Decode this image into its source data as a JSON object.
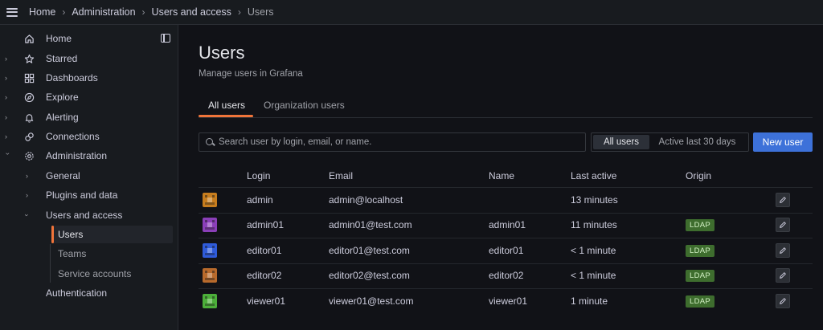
{
  "breadcrumb": [
    "Home",
    "Administration",
    "Users and access",
    "Users"
  ],
  "sidebar": {
    "items": [
      {
        "label": "Home",
        "icon": "home-icon",
        "expandable": false
      },
      {
        "label": "Starred",
        "icon": "star-icon",
        "expandable": true
      },
      {
        "label": "Dashboards",
        "icon": "dashboards-icon",
        "expandable": true
      },
      {
        "label": "Explore",
        "icon": "compass-icon",
        "expandable": true
      },
      {
        "label": "Alerting",
        "icon": "bell-icon",
        "expandable": true
      },
      {
        "label": "Connections",
        "icon": "connections-icon",
        "expandable": true
      },
      {
        "label": "Administration",
        "icon": "gear-icon",
        "expandable": true,
        "expanded": true
      }
    ],
    "admin_children": [
      "General",
      "Plugins and data",
      "Users and access",
      "Authentication"
    ],
    "users_access_children": [
      "Users",
      "Teams",
      "Service accounts"
    ],
    "active": "Users"
  },
  "page": {
    "title": "Users",
    "subtitle": "Manage users in Grafana"
  },
  "tabs": [
    {
      "label": "All users",
      "active": true
    },
    {
      "label": "Organization users",
      "active": false
    }
  ],
  "search": {
    "placeholder": "Search user by login, email, or name.",
    "value": ""
  },
  "filter": {
    "options": [
      "All users",
      "Active last 30 days"
    ],
    "selected": "All users"
  },
  "new_user_label": "New user",
  "table": {
    "columns": [
      "Login",
      "Email",
      "Name",
      "Last active",
      "Origin"
    ],
    "rows": [
      {
        "login": "admin",
        "email": "admin@localhost",
        "name": "",
        "last_active": "13 minutes",
        "origin": "",
        "avatar_color": "#c77d1e"
      },
      {
        "login": "admin01",
        "email": "admin01@test.com",
        "name": "admin01",
        "last_active": "11 minutes",
        "origin": "LDAP",
        "avatar_color": "#8a3fb8"
      },
      {
        "login": "editor01",
        "email": "editor01@test.com",
        "name": "editor01",
        "last_active": "< 1 minute",
        "origin": "LDAP",
        "avatar_color": "#2f5bd9"
      },
      {
        "login": "editor02",
        "email": "editor02@test.com",
        "name": "editor02",
        "last_active": "< 1 minute",
        "origin": "LDAP",
        "avatar_color": "#b86a2c"
      },
      {
        "login": "viewer01",
        "email": "viewer01@test.com",
        "name": "viewer01",
        "last_active": "1 minute",
        "origin": "LDAP",
        "avatar_color": "#4caf3a"
      }
    ]
  },
  "colors": {
    "accent": "#f0743a",
    "primary_button": "#3d71d9",
    "ldap_badge": "#3e6d2e"
  }
}
